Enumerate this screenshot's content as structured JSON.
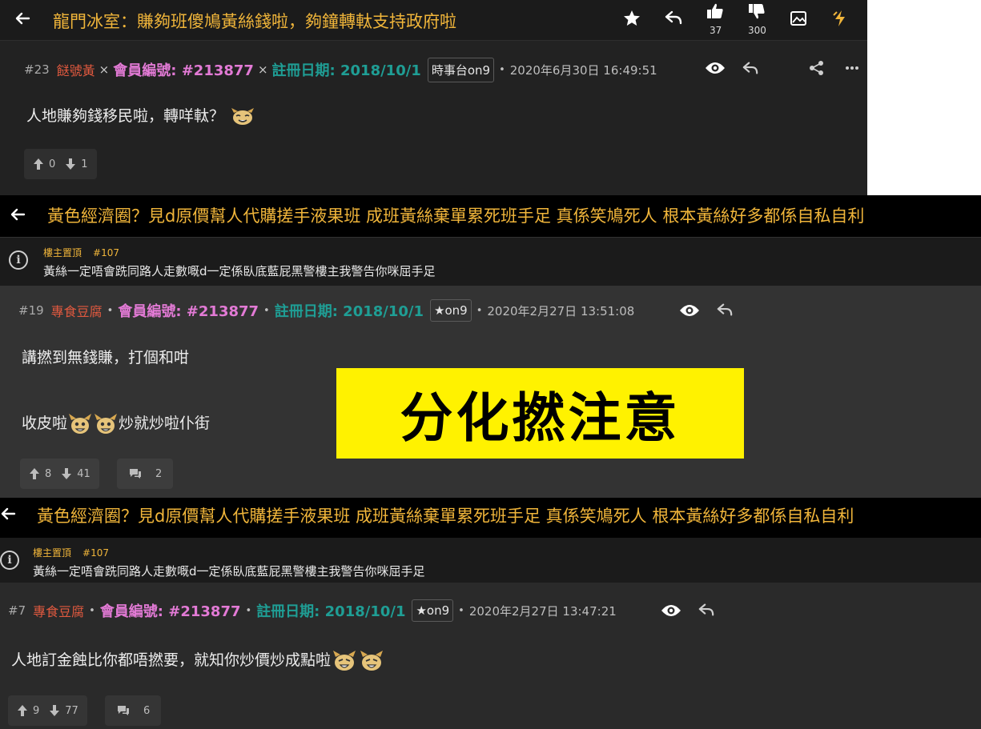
{
  "panel1": {
    "title": "龍門冰室：賺夠班傻鳩黃絲錢啦，夠鐘轉軚支持政府啦",
    "like_count": "37",
    "dislike_count": "300",
    "icons": [
      "back-arrow-icon",
      "star-icon",
      "reply-icon",
      "thumbs-up-icon",
      "thumbs-down-icon",
      "image-icon",
      "lightning-icon"
    ],
    "post": {
      "number": "#23",
      "username": "餸號黃",
      "sep": "×",
      "member_label": "會員編號: #213877",
      "reg_label": "註冊日期: 2018/10/1",
      "tag": "時事台on9",
      "bullet": "•",
      "date": "2020年6月30日 16:49:51",
      "content": "人地賺夠錢移民啦，轉咩軚？",
      "up": "0",
      "down": "1"
    }
  },
  "panel2": {
    "title": "黃色經濟圈？見d原價幫人代購搓手液果班 成班黃絲棄單累死班手足 真係笑鳩死人 根本黃絲好多都係自私自利",
    "pinned_label": "樓主置頂",
    "pinned_num": "#107",
    "pinned_text": "黃絲一定唔會跣同路人走數嘅d一定係臥底藍屁黑警樓主我警告你咪屈手足",
    "post": {
      "number": "#19",
      "username": "專食豆腐",
      "bullet": "•",
      "member_label": "會員編號: #213877",
      "reg_label": "註冊日期: 2018/10/1",
      "tag": "★on9",
      "date": "2020年2月27日 13:51:08",
      "content_line1": "講撚到無錢賺，打個和咁",
      "content_line2a": "收皮啦",
      "content_line2b": "炒就炒啦仆街",
      "up": "8",
      "down": "41",
      "comments": "2"
    }
  },
  "panel3": {
    "title": "黃色經濟圈？見d原價幫人代購搓手液果班 成班黃絲棄單累死班手足 真係笑鳩死人 根本黃絲好多都係自私自利",
    "pinned_label": "樓主置頂",
    "pinned_num": "#107",
    "pinned_text": "黃絲一定唔會跣同路人走數嘅d一定係臥底藍屁黑警樓主我警告你咪屈手足",
    "post": {
      "number": "#7",
      "username": "專食豆腐",
      "bullet": "•",
      "member_label": "會員編號: #213877",
      "reg_label": "註冊日期: 2018/10/1",
      "tag": "★on9",
      "date": "2020年2月27日 13:47:21",
      "content": "人地訂金蝕比你都唔撚要，就知你炒價炒成點啦",
      "up": "9",
      "down": "77",
      "comments": "6"
    }
  },
  "overlay_stamp": "分化撚注意",
  "colors": {
    "dark_bg": "#222222",
    "darker_bg": "#1b1b1b",
    "mid_bg": "#333333",
    "accent_yellow": "#f0b53a",
    "member_pink": "#e27ad5",
    "reg_teal": "#1f9e95",
    "username_red": "#e0593f",
    "stamp_yellow": "#fff200"
  }
}
